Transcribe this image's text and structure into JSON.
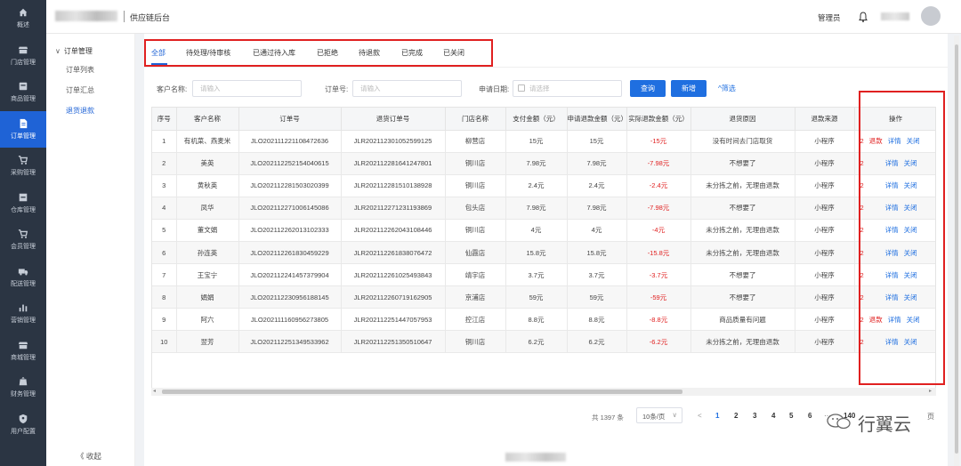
{
  "colors": {
    "nav_bg": "#2b3543",
    "primary": "#1f6fe0",
    "danger": "#e02020"
  },
  "nav": [
    {
      "label": "概述",
      "icon": "home-icon"
    },
    {
      "label": "门店管理",
      "icon": "store-icon"
    },
    {
      "label": "商品管理",
      "icon": "product-icon"
    },
    {
      "label": "订单管理",
      "icon": "order-icon",
      "active": true
    },
    {
      "label": "采购管理",
      "icon": "cart-icon"
    },
    {
      "label": "仓库管理",
      "icon": "warehouse-icon"
    },
    {
      "label": "会员管理",
      "icon": "member-icon"
    },
    {
      "label": "配送管理",
      "icon": "truck-icon"
    },
    {
      "label": "营销管理",
      "icon": "chart-icon"
    },
    {
      "label": "商城管理",
      "icon": "mall-icon"
    },
    {
      "label": "财务管理",
      "icon": "finance-icon"
    },
    {
      "label": "用户配置",
      "icon": "user-config-icon"
    }
  ],
  "topbar": {
    "title": "供应链后台",
    "role": "管理员"
  },
  "subnav": {
    "group": "订单管理",
    "items": [
      "订单列表",
      "订单汇总",
      "退货退款"
    ],
    "collapse": "收起"
  },
  "tabs": [
    "全部",
    "待处理/待审核",
    "已通过待入库",
    "已拒绝",
    "待退款",
    "已完成",
    "已关闭"
  ],
  "filters": {
    "customer_label": "客户名称:",
    "customer_placeholder": "请输入",
    "order_label": "订单号:",
    "order_placeholder": "请输入",
    "date_label": "申请日期:",
    "date_placeholder": "请选择",
    "query": "查询",
    "add": "新增",
    "more": "筛选"
  },
  "table": {
    "headers": [
      "序号",
      "客户名称",
      "订单号",
      "退货订单号",
      "门店名称",
      "支付金额（元）",
      "申请退款金额（元）",
      "实际退款金额（元）",
      "退货原因",
      "退款来源",
      "操作"
    ],
    "rows": [
      {
        "no": "1",
        "customer": "有机菜、燕麦米",
        "order": "JLO202111221108472636",
        "return_order": "JLR202112301052599125",
        "store": "柳营店",
        "paid": "15元",
        "apply": "15元",
        "actual": "-15元",
        "reason": "没有时间去门店取货",
        "source": "小程序",
        "cut": "2",
        "ops": [
          "退款",
          "详情",
          "关闭"
        ]
      },
      {
        "no": "2",
        "customer": "美英",
        "order": "JLO202112252154040615",
        "return_order": "JLR202112281641247801",
        "store": "铜川店",
        "paid": "7.98元",
        "apply": "7.98元",
        "actual": "-7.98元",
        "reason": "不想要了",
        "source": "小程序",
        "cut": "2",
        "ops": [
          "详情",
          "关闭"
        ]
      },
      {
        "no": "3",
        "customer": "黄秋英",
        "order": "JLO202112281503020399",
        "return_order": "JLR202112281510138928",
        "store": "铜川店",
        "paid": "2.4元",
        "apply": "2.4元",
        "actual": "-2.4元",
        "reason": "未分拣之前，无理由退款",
        "source": "小程序",
        "cut": "2",
        "ops": [
          "详情",
          "关闭"
        ]
      },
      {
        "no": "4",
        "customer": "凤华",
        "order": "JLO202112271006145086",
        "return_order": "JLR202112271231193869",
        "store": "包头店",
        "paid": "7.98元",
        "apply": "7.98元",
        "actual": "-7.98元",
        "reason": "不想要了",
        "source": "小程序",
        "cut": "2",
        "ops": [
          "详情",
          "关闭"
        ]
      },
      {
        "no": "5",
        "customer": "董文娟",
        "order": "JLO202112262013102333",
        "return_order": "JLR202112262043108446",
        "store": "铜川店",
        "paid": "4元",
        "apply": "4元",
        "actual": "-4元",
        "reason": "未分拣之前，无理由退款",
        "source": "小程序",
        "cut": "2",
        "ops": [
          "详情",
          "关闭"
        ]
      },
      {
        "no": "6",
        "customer": "孙连英",
        "order": "JLO202112261830459229",
        "return_order": "JLR202112261838076472",
        "store": "仙霞店",
        "paid": "15.8元",
        "apply": "15.8元",
        "actual": "-15.8元",
        "reason": "未分拣之前，无理由退款",
        "source": "小程序",
        "cut": "2",
        "ops": [
          "详情",
          "关闭"
        ]
      },
      {
        "no": "7",
        "customer": "王宝宁",
        "order": "JLO202112241457379904",
        "return_order": "JLR202112261025493843",
        "store": "靖宇店",
        "paid": "3.7元",
        "apply": "3.7元",
        "actual": "-3.7元",
        "reason": "不想要了",
        "source": "小程序",
        "cut": "2",
        "ops": [
          "详情",
          "关闭"
        ]
      },
      {
        "no": "8",
        "customer": "娟娟",
        "order": "JLO202112230956188145",
        "return_order": "JLR202112260719162905",
        "store": "京浦店",
        "paid": "59元",
        "apply": "59元",
        "actual": "-59元",
        "reason": "不想要了",
        "source": "小程序",
        "cut": "2",
        "ops": [
          "详情",
          "关闭"
        ]
      },
      {
        "no": "9",
        "customer": "阿六",
        "order": "JLO202111160956273805",
        "return_order": "JLR202112251447057953",
        "store": "控江店",
        "paid": "8.8元",
        "apply": "8.8元",
        "actual": "-8.8元",
        "reason": "商品质量有问题",
        "source": "小程序",
        "cut": "2",
        "ops": [
          "退款",
          "详情",
          "关闭"
        ]
      },
      {
        "no": "10",
        "customer": "翌芳",
        "order": "JLO202112251349533962",
        "return_order": "JLR202112251350510647",
        "store": "铜川店",
        "paid": "6.2元",
        "apply": "6.2元",
        "actual": "-6.2元",
        "reason": "未分拣之前，无理由退款",
        "source": "小程序",
        "cut": "2",
        "ops": [
          "详情",
          "关闭"
        ]
      }
    ]
  },
  "pagination": {
    "total": "共 1397 条",
    "page_size": "10条/页",
    "pages": [
      "1",
      "2",
      "3",
      "4",
      "5",
      "6",
      "140"
    ],
    "current": "1",
    "ellipsis": "···",
    "goto_suffix": "页"
  },
  "watermark": "行翼云"
}
